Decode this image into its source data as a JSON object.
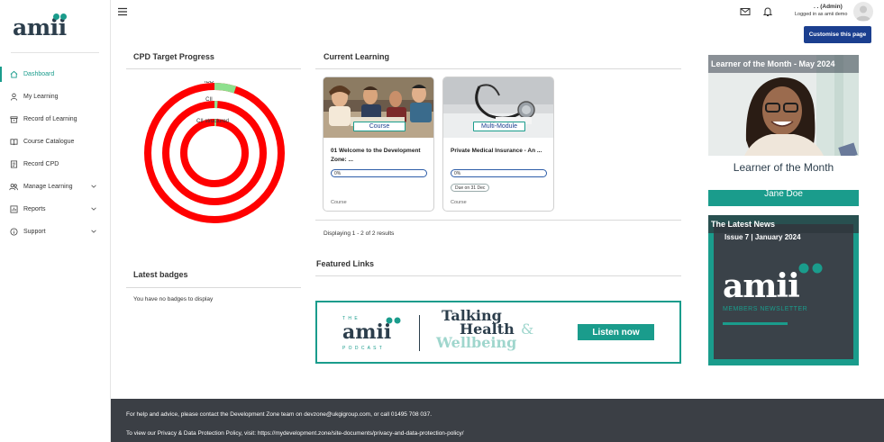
{
  "logo": {
    "text": "amii"
  },
  "sidebar": {
    "items": [
      {
        "label": "Dashboard",
        "icon": "home-icon",
        "active": true
      },
      {
        "label": "My Learning",
        "icon": "user-icon"
      },
      {
        "label": "Record of Learning",
        "icon": "archive-icon"
      },
      {
        "label": "Course Catalogue",
        "icon": "book-open-icon"
      },
      {
        "label": "Record CPD",
        "icon": "document-icon"
      },
      {
        "label": "Manage Learning",
        "icon": "users-icon",
        "expandable": true
      },
      {
        "label": "Reports",
        "icon": "chart-icon",
        "expandable": true
      },
      {
        "label": "Support",
        "icon": "info-icon",
        "expandable": true
      }
    ]
  },
  "header": {
    "user_name": ". .  (Admin)",
    "user_sub": "Logged in as amii demo",
    "customise_label": "Customise this page"
  },
  "cpd": {
    "title": "CPD Target Progress",
    "rings": [
      {
        "label": "IDD",
        "progress": 0.05
      },
      {
        "label": "CII",
        "progress": 0.01
      },
      {
        "label": "CII structured",
        "progress": 0.005
      }
    ]
  },
  "current_learning": {
    "title": "Current Learning",
    "cards": [
      {
        "tag": "Course",
        "title": "01 Welcome to the Development Zone: ...",
        "progress": "0%",
        "type": "Course"
      },
      {
        "tag": "Multi-Module",
        "title": "Private Medical Insurance - An ...",
        "progress": "0%",
        "due": "Due on 31 Dec",
        "type": "Course"
      }
    ],
    "results": "Displaying 1 - 2 of 2 results"
  },
  "badges": {
    "title": "Latest badges",
    "empty": "You have no badges to display"
  },
  "featured": {
    "title": "Featured Links",
    "banner": {
      "the": "T H E",
      "brand": "amii",
      "podcast": "P O D C A S T",
      "line1": "Talking",
      "line2": "Health",
      "amp": "&",
      "line3": "Wellbeing",
      "cta": "Listen now"
    }
  },
  "lotm": {
    "header": "Learner of the Month - May 2024",
    "caption": "Learner of the Month",
    "name": "Jane Doe"
  },
  "news": {
    "header": "The Latest News",
    "issue": "Issue 7 | January 2024",
    "brand": "amii",
    "subtitle": "MEMBERS NEWSLETTER"
  },
  "footer": {
    "line1": "For help and advice, please contact the Development Zone team on devzone@ukgigroup.com, or call 01495 708 037.",
    "line2": "To view our Privacy & Data Protection Policy, visit: https://mydevelopment.zone/site-documents/privacy-and-data-protection-policy/"
  },
  "colors": {
    "accent": "#1a9c8c",
    "brand_dark": "#2c3e4c",
    "button": "#1b3f8f",
    "ring": "#ff0000",
    "ring_progress": "#8ee08e",
    "footer": "#3b3f45"
  }
}
